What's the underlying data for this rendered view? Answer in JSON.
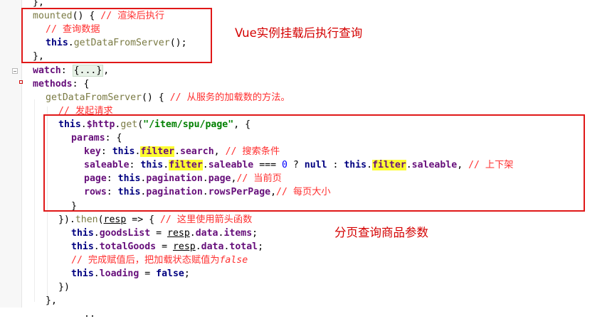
{
  "code_lines": [
    {
      "tokens": [
        {
          "t": "},",
          "c": "plain"
        }
      ]
    },
    {
      "tokens": [
        {
          "t": "mounted",
          "c": "fn"
        },
        {
          "t": "() { ",
          "c": "plain"
        },
        {
          "t": "// 渲染后执行",
          "c": "cmt"
        }
      ]
    },
    {
      "tokens": [
        {
          "t": "// 查询数据",
          "c": "cmt"
        }
      ]
    },
    {
      "tokens": [
        {
          "t": "this",
          "c": "kw"
        },
        {
          "t": ".",
          "c": "plain"
        },
        {
          "t": "getDataFromServer",
          "c": "fn"
        },
        {
          "t": "();",
          "c": "plain"
        }
      ]
    },
    {
      "tokens": [
        {
          "t": "},",
          "c": "plain"
        }
      ]
    },
    {
      "tokens": [
        {
          "t": "watch",
          "c": "prop"
        },
        {
          "t": ": ",
          "c": "plain"
        },
        {
          "t": "{...}",
          "c": "fold-txt"
        },
        {
          "t": ",",
          "c": "plain"
        }
      ]
    },
    {
      "tokens": [
        {
          "t": "methods",
          "c": "prop"
        },
        {
          "t": ": {",
          "c": "plain"
        }
      ]
    },
    {
      "tokens": [
        {
          "t": "getDataFromServer",
          "c": "fn"
        },
        {
          "t": "() { ",
          "c": "plain"
        },
        {
          "t": "// 从服务的加载数的方法。",
          "c": "cmt"
        }
      ]
    },
    {
      "tokens": [
        {
          "t": "// 发起请求",
          "c": "cmt"
        }
      ]
    },
    {
      "tokens": [
        {
          "t": "this",
          "c": "kw"
        },
        {
          "t": ".",
          "c": "plain"
        },
        {
          "t": "$http",
          "c": "prop"
        },
        {
          "t": ".",
          "c": "plain"
        },
        {
          "t": "get",
          "c": "fn"
        },
        {
          "t": "(",
          "c": "plain"
        },
        {
          "t": "\"/item/spu/page\"",
          "c": "str"
        },
        {
          "t": ", {",
          "c": "plain"
        }
      ]
    },
    {
      "tokens": [
        {
          "t": "params",
          "c": "prop"
        },
        {
          "t": ": {",
          "c": "plain"
        }
      ]
    },
    {
      "tokens": [
        {
          "t": "key",
          "c": "prop"
        },
        {
          "t": ": ",
          "c": "plain"
        },
        {
          "t": "this",
          "c": "kw"
        },
        {
          "t": ".",
          "c": "plain"
        },
        {
          "t": "filter",
          "c": "prop hl"
        },
        {
          "t": ".",
          "c": "plain"
        },
        {
          "t": "search",
          "c": "prop"
        },
        {
          "t": ", ",
          "c": "plain"
        },
        {
          "t": "// 搜索条件",
          "c": "cmt"
        }
      ]
    },
    {
      "tokens": [
        {
          "t": "saleable",
          "c": "prop"
        },
        {
          "t": ": ",
          "c": "plain"
        },
        {
          "t": "this",
          "c": "kw"
        },
        {
          "t": ".",
          "c": "plain"
        },
        {
          "t": "filter",
          "c": "prop hl"
        },
        {
          "t": ".",
          "c": "plain"
        },
        {
          "t": "saleable",
          "c": "prop"
        },
        {
          "t": " === ",
          "c": "plain"
        },
        {
          "t": "0",
          "c": "num"
        },
        {
          "t": " ? ",
          "c": "plain"
        },
        {
          "t": "null",
          "c": "kw"
        },
        {
          "t": " : ",
          "c": "plain"
        },
        {
          "t": "this",
          "c": "kw"
        },
        {
          "t": ".",
          "c": "plain"
        },
        {
          "t": "filter",
          "c": "prop hl"
        },
        {
          "t": ".",
          "c": "plain"
        },
        {
          "t": "saleable",
          "c": "prop"
        },
        {
          "t": ", ",
          "c": "plain"
        },
        {
          "t": "// 上下架",
          "c": "cmt"
        }
      ]
    },
    {
      "tokens": [
        {
          "t": "page",
          "c": "prop"
        },
        {
          "t": ": ",
          "c": "plain"
        },
        {
          "t": "this",
          "c": "kw"
        },
        {
          "t": ".",
          "c": "plain"
        },
        {
          "t": "pagination",
          "c": "prop"
        },
        {
          "t": ".",
          "c": "plain"
        },
        {
          "t": "page",
          "c": "prop"
        },
        {
          "t": ",",
          "c": "plain"
        },
        {
          "t": "// 当前页",
          "c": "cmt"
        }
      ]
    },
    {
      "tokens": [
        {
          "t": "rows",
          "c": "prop"
        },
        {
          "t": ": ",
          "c": "plain"
        },
        {
          "t": "this",
          "c": "kw"
        },
        {
          "t": ".",
          "c": "plain"
        },
        {
          "t": "pagination",
          "c": "prop"
        },
        {
          "t": ".",
          "c": "plain"
        },
        {
          "t": "rowsPerPage",
          "c": "prop"
        },
        {
          "t": ",",
          "c": "plain"
        },
        {
          "t": "// 每页大小",
          "c": "cmt"
        }
      ]
    },
    {
      "tokens": [
        {
          "t": "}",
          "c": "plain"
        }
      ]
    },
    {
      "tokens": [
        {
          "t": "}).",
          "c": "plain"
        },
        {
          "t": "then",
          "c": "fn"
        },
        {
          "t": "(",
          "c": "plain"
        },
        {
          "t": "resp",
          "c": "plain ul"
        },
        {
          "t": " => { ",
          "c": "plain"
        },
        {
          "t": "// 这里使用箭头函数",
          "c": "cmt"
        }
      ]
    },
    {
      "tokens": [
        {
          "t": "this",
          "c": "kw"
        },
        {
          "t": ".",
          "c": "plain"
        },
        {
          "t": "goodsList",
          "c": "prop"
        },
        {
          "t": " = ",
          "c": "plain"
        },
        {
          "t": "resp",
          "c": "plain ul"
        },
        {
          "t": ".",
          "c": "plain"
        },
        {
          "t": "data",
          "c": "prop"
        },
        {
          "t": ".",
          "c": "plain"
        },
        {
          "t": "items",
          "c": "prop"
        },
        {
          "t": ";",
          "c": "plain"
        }
      ]
    },
    {
      "tokens": [
        {
          "t": "this",
          "c": "kw"
        },
        {
          "t": ".",
          "c": "plain"
        },
        {
          "t": "totalGoods",
          "c": "prop"
        },
        {
          "t": " = ",
          "c": "plain"
        },
        {
          "t": "resp",
          "c": "plain ul"
        },
        {
          "t": ".",
          "c": "plain"
        },
        {
          "t": "data",
          "c": "prop"
        },
        {
          "t": ".",
          "c": "plain"
        },
        {
          "t": "total",
          "c": "prop"
        },
        {
          "t": ";",
          "c": "plain"
        }
      ]
    },
    {
      "tokens": [
        {
          "t": "// 完成赋值后，把加载状态赋值为",
          "c": "cmt"
        },
        {
          "t": "false",
          "c": "cmt-i"
        }
      ]
    },
    {
      "tokens": [
        {
          "t": "this",
          "c": "kw"
        },
        {
          "t": ".",
          "c": "plain"
        },
        {
          "t": "loading",
          "c": "prop"
        },
        {
          "t": " = ",
          "c": "plain"
        },
        {
          "t": "false",
          "c": "kw"
        },
        {
          "t": ";",
          "c": "plain"
        }
      ]
    },
    {
      "tokens": [
        {
          "t": "})",
          "c": "plain"
        }
      ]
    },
    {
      "tokens": [
        {
          "t": "},",
          "c": "plain"
        }
      ]
    },
    {
      "tokens": [
        {
          "t": "..",
          "c": "plain"
        }
      ]
    }
  ],
  "annotations": {
    "mounted_note": "Vue实例挂载后执行查询",
    "params_note": "分页查询商品参数"
  }
}
